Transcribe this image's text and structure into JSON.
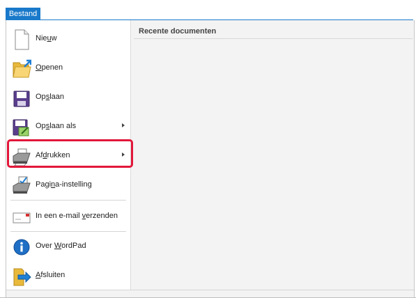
{
  "tabs": {
    "file": "Bestand"
  },
  "menu": {
    "items": [
      {
        "name": "menu-item-nieuw",
        "icon": "new-document-icon",
        "pre": "Nie",
        "acc": "u",
        "post": "w",
        "submenu": false
      },
      {
        "name": "menu-item-openen",
        "icon": "open-folder-icon",
        "pre": "",
        "acc": "O",
        "post": "penen",
        "submenu": false
      },
      {
        "name": "menu-item-opslaan",
        "icon": "save-icon",
        "pre": "Op",
        "acc": "s",
        "post": "laan",
        "submenu": false
      },
      {
        "name": "menu-item-opslaan-als",
        "icon": "save-as-icon",
        "pre": "Op",
        "acc": "s",
        "post": "laan als",
        "submenu": true
      },
      {
        "name": "menu-item-afdrukken",
        "icon": "printer-icon",
        "pre": "Af",
        "acc": "d",
        "post": "rukken",
        "submenu": true
      },
      {
        "name": "menu-item-pagina-instelling",
        "icon": "page-setup-icon",
        "pre": "Pagi",
        "acc": "n",
        "post": "a-instelling",
        "submenu": false
      },
      {
        "name": "menu-item-email",
        "icon": "email-icon",
        "pre": "In een e-mail ",
        "acc": "v",
        "post": "erzenden",
        "submenu": false
      },
      {
        "name": "menu-item-over-wordpad",
        "icon": "info-icon",
        "pre": "Over ",
        "acc": "W",
        "post": "ordPad",
        "submenu": false
      },
      {
        "name": "menu-item-afsluiten",
        "icon": "exit-icon",
        "pre": "",
        "acc": "A",
        "post": "fsluiten",
        "submenu": false
      }
    ]
  },
  "recent": {
    "title": "Recente documenten"
  },
  "colors": {
    "accent": "#1979ca",
    "highlight": "#e2173a"
  }
}
